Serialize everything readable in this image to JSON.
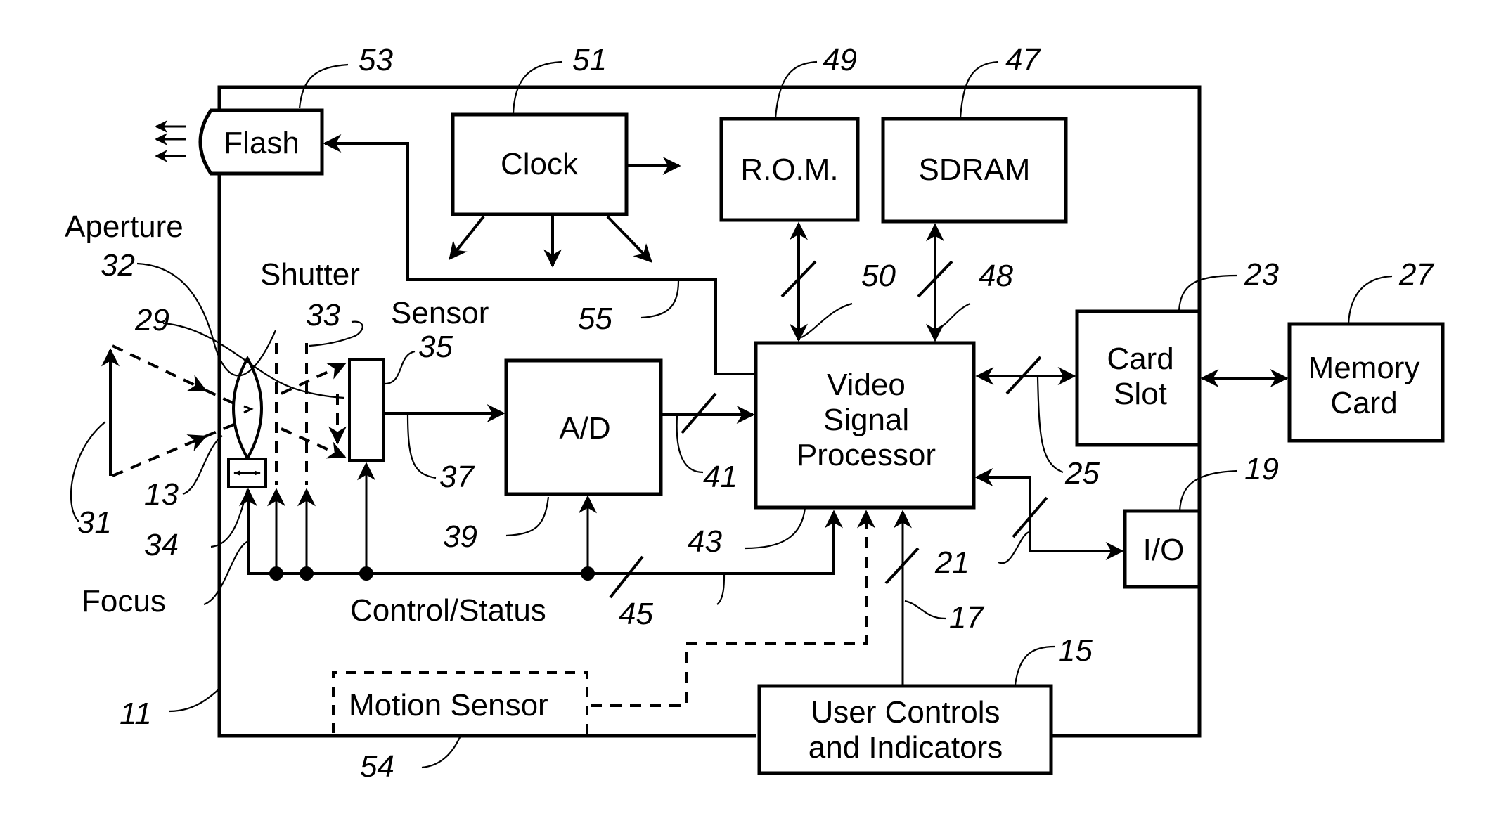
{
  "figure": {
    "blocks": {
      "flash": "Flash",
      "clock": "Clock",
      "rom": "R.O.M.",
      "sdram": "SDRAM",
      "ad": "A/D",
      "vsp": [
        "Video",
        "Signal",
        "Processor"
      ],
      "card_slot": [
        "Card",
        "Slot"
      ],
      "memory_card": [
        "Memory",
        "Card"
      ],
      "io": "I/O",
      "user_controls": [
        "User Controls",
        "and Indicators"
      ],
      "motion_sensor": "Motion Sensor"
    },
    "labels": {
      "aperture": "Aperture",
      "shutter": "Shutter",
      "sensor": "Sensor",
      "focus": "Focus",
      "control_status": "Control/Status"
    },
    "refs": {
      "r11": "11",
      "r13": "13",
      "r15": "15",
      "r17": "17",
      "r19": "19",
      "r21": "21",
      "r23": "23",
      "r25": "25",
      "r27": "27",
      "r29": "29",
      "r31": "31",
      "r32": "32",
      "r33": "33",
      "r34": "34",
      "r35": "35",
      "r37": "37",
      "r39": "39",
      "r41": "41",
      "r43": "43",
      "r45": "45",
      "r47": "47",
      "r48": "48",
      "r49": "49",
      "r50": "50",
      "r51": "51",
      "r53": "53",
      "r54": "54",
      "r55": "55"
    }
  }
}
